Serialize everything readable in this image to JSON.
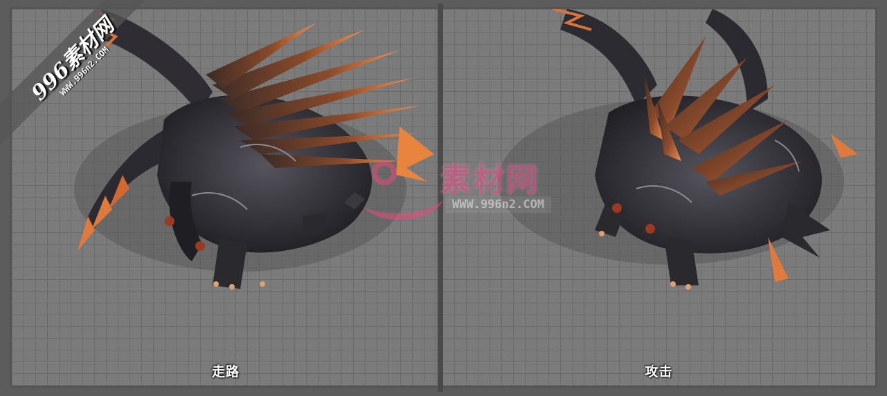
{
  "panels": [
    {
      "caption": "走路",
      "pose": "walk"
    },
    {
      "caption": "攻击",
      "pose": "attack"
    }
  ],
  "watermark": {
    "corner_brand": "996素材网",
    "corner_url": "WWW.996n2.COM",
    "center_brand": "素材网",
    "center_url": "WWW.996n2.COM"
  },
  "colors": {
    "background": "#5c5c5c",
    "grid": "#7b7b7b",
    "spike_orange": "#d9743a",
    "body_dark": "#2b2a30",
    "watermark_pink": "#ef4e8c"
  }
}
